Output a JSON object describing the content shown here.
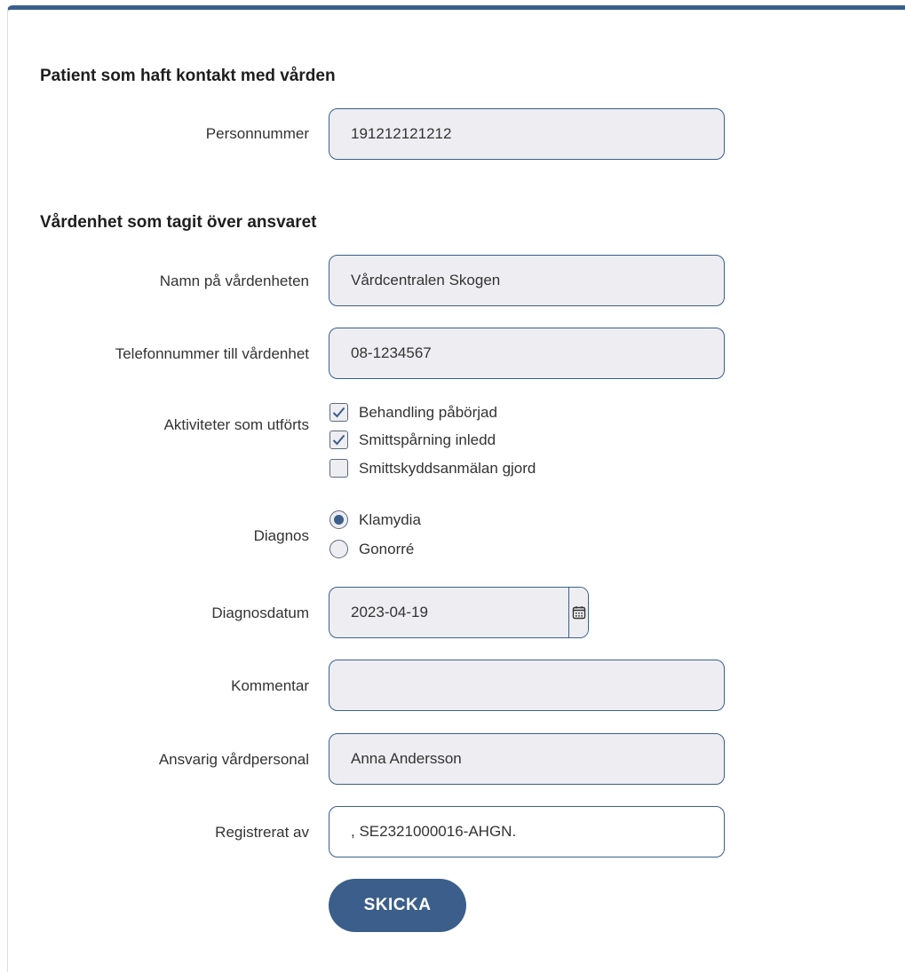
{
  "sections": {
    "patient_title": "Patient som haft kontakt med vården",
    "unit_title": "Vårdenhet som tagit över ansvaret"
  },
  "fields": {
    "personnummer": {
      "label": "Personnummer",
      "value": "191212121212"
    },
    "unit_name": {
      "label": "Namn på vårdenheten",
      "value": "Vårdcentralen Skogen"
    },
    "unit_phone": {
      "label": "Telefonnummer till vårdenhet",
      "value": "08-1234567"
    },
    "activities": {
      "label": "Aktiviteter som utförts",
      "options": [
        {
          "label": "Behandling påbörjad",
          "checked": true
        },
        {
          "label": "Smittspårning inledd",
          "checked": true
        },
        {
          "label": "Smittskyddsanmälan gjord",
          "checked": false
        }
      ]
    },
    "diagnosis": {
      "label": "Diagnos",
      "options": [
        {
          "label": "Klamydia",
          "selected": true
        },
        {
          "label": "Gonorré",
          "selected": false
        }
      ]
    },
    "diagnosis_date": {
      "label": "Diagnosdatum",
      "value": "2023-04-19"
    },
    "comment": {
      "label": "Kommentar",
      "value": ""
    },
    "responsible": {
      "label": "Ansvarig vårdpersonal",
      "value": "Anna Andersson"
    },
    "registered_by": {
      "label": "Registrerat av",
      "value": ", SE2321000016-AHGN."
    }
  },
  "submit_label": "SKICKA",
  "colors": {
    "accent": "#3b5f8a",
    "field_bg": "#eeeef2",
    "text": "#333333"
  },
  "icons": {
    "date_picker": "calendar-icon",
    "checked": "checkmark-icon"
  }
}
